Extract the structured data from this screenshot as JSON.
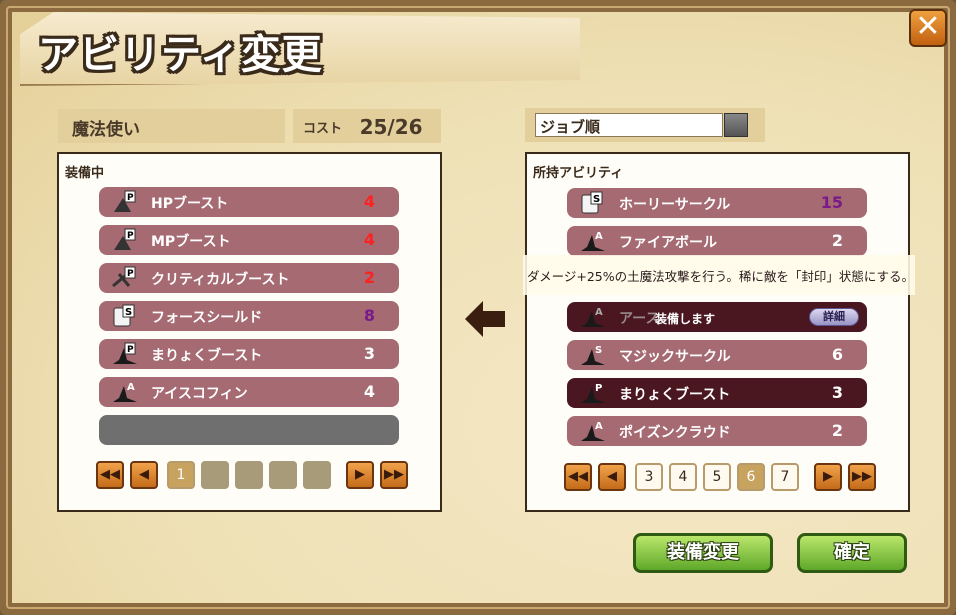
{
  "title": "アビリティ変更",
  "job": {
    "name": "魔法使い"
  },
  "cost": {
    "label": "コスト",
    "value": "25/26"
  },
  "sort": {
    "label": "ジョブ順"
  },
  "equipped": {
    "title": "装備中",
    "slots": [
      {
        "name": "HPブースト",
        "cost": "4",
        "type": "P",
        "cost_color": "#ff2020"
      },
      {
        "name": "MPブースト",
        "cost": "4",
        "type": "P",
        "cost_color": "#ff2020"
      },
      {
        "name": "クリティカルブースト",
        "cost": "2",
        "type": "P",
        "cost_color": "#ff2020"
      },
      {
        "name": "フォースシールド",
        "cost": "8",
        "type": "S",
        "cost_color": "#7a1a8a"
      },
      {
        "name": "まりょくブースト",
        "cost": "3",
        "type": "P",
        "cost_color": "#ffffff"
      },
      {
        "name": "アイスコフィン",
        "cost": "4",
        "type": "A",
        "cost_color": "#ffffff"
      }
    ],
    "pages": [
      "1"
    ]
  },
  "owned": {
    "title": "所持アビリティ",
    "slots": [
      {
        "name": "ホーリーサークル",
        "cost": "15",
        "type": "S",
        "cost_color": "#7a1a8a"
      },
      {
        "name": "ファイアボール",
        "cost": "2",
        "type": "A",
        "cost_color": "#ffffff"
      },
      {
        "name": "アース",
        "equip_label": "装備します",
        "detail_label": "詳細",
        "type": "A"
      },
      {
        "name": "マジックサークル",
        "cost": "6",
        "type": "S",
        "cost_color": "#ffffff"
      },
      {
        "name": "まりょくブースト",
        "cost": "3",
        "type": "P",
        "cost_color": "#ffffff"
      },
      {
        "name": "ポイズンクラウド",
        "cost": "2",
        "type": "A",
        "cost_color": "#ffffff"
      }
    ],
    "pages": [
      "3",
      "4",
      "5",
      "6",
      "7"
    ],
    "current_page": "6"
  },
  "tooltip": "ダメージ+25%の土魔法攻撃を行う。稀に敵を「封印」状態にする。",
  "buttons": {
    "change": "装備変更",
    "confirm": "確定",
    "close": "✕"
  },
  "icons": {
    "close": "close-icon",
    "transfer": "arrow-left-icon",
    "first": "double-left-icon",
    "prev": "left-icon",
    "next": "right-icon",
    "last": "double-right-icon"
  },
  "colors": {
    "slot": "#a56a72",
    "slot_selected": "#4a1620",
    "accent_green": "#5fa829",
    "nav_orange": "#c46b1a"
  }
}
